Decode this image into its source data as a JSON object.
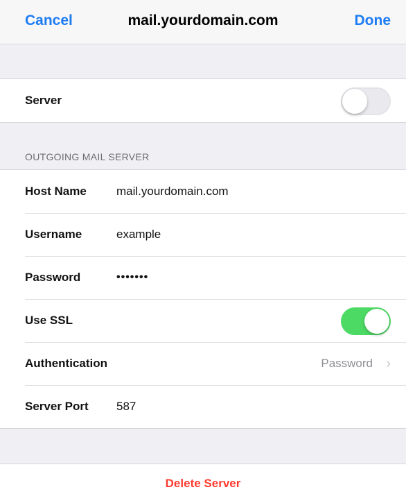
{
  "navbar": {
    "cancel_label": "Cancel",
    "title": "mail.yourdomain.com",
    "done_label": "Done"
  },
  "server_group": {
    "server_label": "Server",
    "server_toggle_on": false
  },
  "outgoing": {
    "section_title": "OUTGOING MAIL SERVER",
    "host_name_label": "Host Name",
    "host_name_value": "mail.yourdomain.com",
    "username_label": "Username",
    "username_value": "example",
    "password_label": "Password",
    "password_value": "•••••••",
    "use_ssl_label": "Use SSL",
    "use_ssl_on": true,
    "authentication_label": "Authentication",
    "authentication_value": "Password",
    "server_port_label": "Server Port",
    "server_port_value": "587"
  },
  "delete_label": "Delete Server",
  "colors": {
    "accent": "#1e7cf2",
    "toggle_on": "#4cd964",
    "destructive": "#ff3b30"
  },
  "icons": {
    "chevron": "chevron-right-icon"
  }
}
